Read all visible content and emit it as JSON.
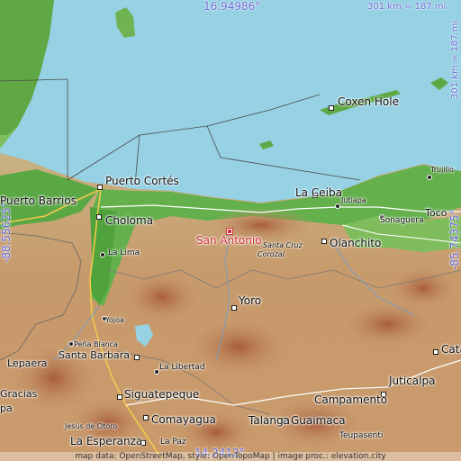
{
  "map": {
    "coords": {
      "top_lat": "16.94986°",
      "bottom_lat": "14.2412°",
      "left_lon": "-88.55625°",
      "right_lon": "-85.74375°"
    },
    "scale": {
      "horizontal": "301 km = 187 mi",
      "vertical": "301 km = 187 mi"
    },
    "target": {
      "name": "San Antonio"
    },
    "places": {
      "puerto_cortes": "Puerto Cortés",
      "puerto_barrios": "Puerto Barrios",
      "choloma": "Choloma",
      "la_lima": "La Lima",
      "la_ceiba": "La Ceiba",
      "jutiapa": "Jutiapa",
      "coxen_hole": "Coxen Hole",
      "trujillo": "Trujillo",
      "sonaguera": "Sonaguera",
      "tocoa": "Toco",
      "olanchito": "Olanchito",
      "santa_cruz": "Santa Cruz",
      "corozal": "Corozal",
      "yoro": "Yoro",
      "yojoa": "Yojoa",
      "pena_blanca": "Peña Blanca",
      "santa_barbara": "Santa Barbara",
      "lepaera": "Lepaera",
      "gracias": "Gracias",
      "la_libertad": "La Libertad",
      "siguatepeque": "Siguatepeque",
      "comayagua": "Comayagua",
      "jesus_de_otoro": "Jesús de Otoro",
      "la_esperanza": "La Esperanza",
      "la_paz": "La Paz",
      "campamento": "Campamento",
      "juticalpa": "Juticalpa",
      "talanga": "Talanga",
      "guaimaca": "Guaimaca",
      "teupasenti": "Teupasenti",
      "catacamas": "Cata",
      "ypa": "pa"
    },
    "attribution": "map data: OpenStreetMap, style: OpenTopoMap | image proc.: elevation.city"
  },
  "colors": {
    "sea": "#96d1e4",
    "lowland": "#64b04e",
    "target": "#d52e3a",
    "coord_text": "#6a6ad4"
  }
}
